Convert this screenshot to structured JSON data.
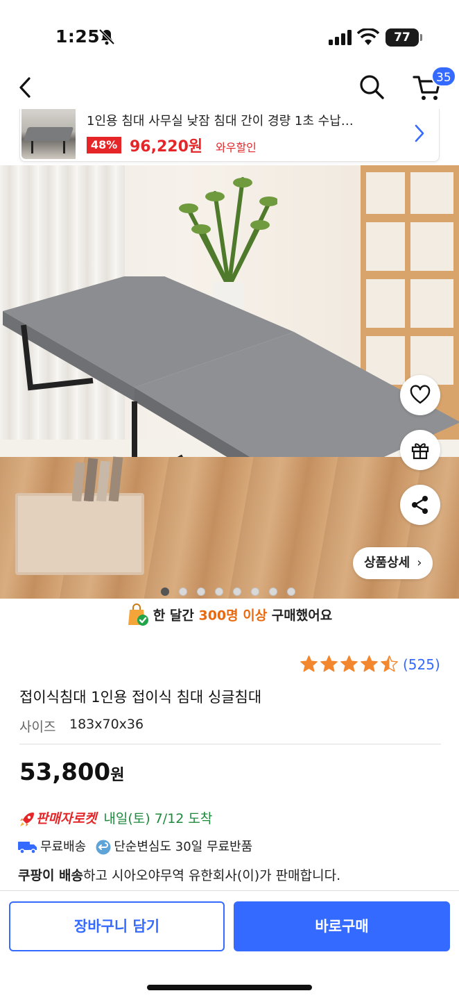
{
  "status_bar": {
    "time": "1:25",
    "battery": "77"
  },
  "nav": {
    "cart_count": "35"
  },
  "strip": {
    "title": "1인용 침대 사무실 낮잠 침대 간이 경량 1초 수납…",
    "discount": "48%",
    "price": "96,220원",
    "tag": "와우할인"
  },
  "hero": {
    "detail_button": "상품상세",
    "dots_total": 8,
    "dots_active": 1
  },
  "purchase_info": {
    "prefix": "한 달간 ",
    "highlight": "300명 이상",
    "suffix": " 구매했어요"
  },
  "rating": {
    "stars": 4.5,
    "count": "(525)"
  },
  "product": {
    "title": "접이식침대 1인용 접이식 침대 싱글침대",
    "option_label": "사이즈",
    "option_value": "183x70x36",
    "price_number": "53,800",
    "price_unit": "원"
  },
  "delivery": {
    "rocket_label": "판매자로켓",
    "arrival": "내일(토) 7/12 도착",
    "free_shipping": "무료배송",
    "free_return": "단순변심도 30일 무료반품",
    "seller_bold": "쿠팡이 배송",
    "seller_rest": "하고 시아오야무역 유한회사(이)가 판매합니다."
  },
  "actions": {
    "cart": "장바구니 담기",
    "buy": "바로구매"
  },
  "colors": {
    "accent": "#346aff",
    "sale": "#e52528",
    "arrival": "#1d8a3b",
    "highlight": "#e86a10"
  }
}
